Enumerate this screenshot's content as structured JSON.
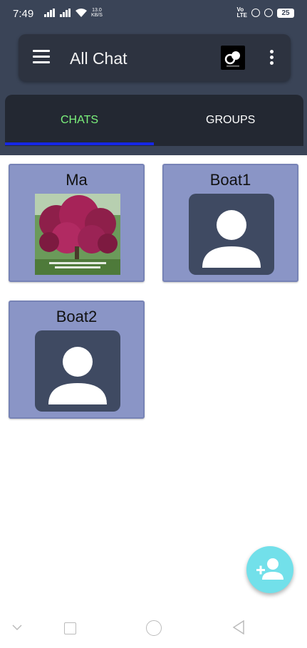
{
  "status_bar": {
    "time": "7:49",
    "net_speed_value": "13.0",
    "net_speed_unit": "KB/S",
    "vo_top": "Vo",
    "vo_bottom": "LTE",
    "battery": "25"
  },
  "toolbar": {
    "title": "All Chat",
    "menu_icon": "hamburger-menu-icon",
    "more_icon": "more-vert-icon"
  },
  "tabs": [
    {
      "label": "CHATS",
      "active": true
    },
    {
      "label": "GROUPS",
      "active": false
    }
  ],
  "chats": [
    {
      "name": "Ma",
      "avatar": "flower-tree-photo"
    },
    {
      "name": "Boat1",
      "avatar": "default-person-icon"
    },
    {
      "name": "Boat2",
      "avatar": "default-person-icon"
    }
  ],
  "fab": {
    "icon": "add-person-icon"
  },
  "colors": {
    "appbar": "#3a4457",
    "toolbar": "#2d3340",
    "tabbar": "#232832",
    "active_tab_text": "#7cf27c",
    "tab_indicator": "#1627e6",
    "card": "#8a95c6",
    "avatar_bg": "#3f4a62",
    "fab": "#72e0ea"
  }
}
